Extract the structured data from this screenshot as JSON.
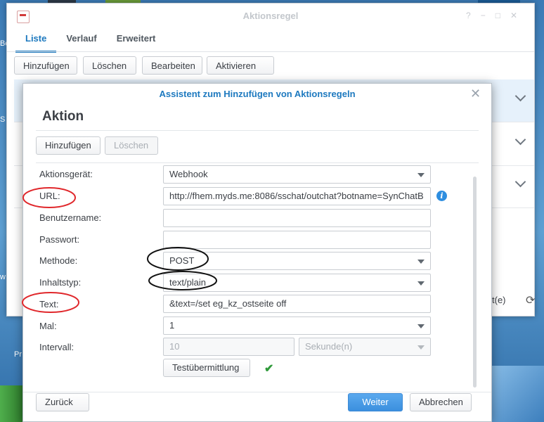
{
  "window": {
    "title": "Aktionsregel",
    "tabs": [
      {
        "label": "Liste",
        "active": true
      },
      {
        "label": "Verlauf",
        "active": false
      },
      {
        "label": "Erweitert",
        "active": false
      }
    ],
    "toolbar": {
      "add": "Hinzufügen",
      "delete": "Löschen",
      "edit": "Bearbeiten",
      "activate": "Aktivieren"
    },
    "footer_text": "t(e)"
  },
  "desktop": {
    "left_labels": [
      "Be",
      "S",
      "w",
      "Pr"
    ]
  },
  "dialog": {
    "title": "Assistent zum Hinzufügen von Aktionsregeln",
    "heading": "Aktion",
    "add_button": "Hinzufügen",
    "delete_button": "Löschen",
    "fields": {
      "device": {
        "label": "Aktionsgerät:",
        "value": "Webhook"
      },
      "url": {
        "label": "URL:",
        "value": "http://fhem.myds.me:8086/sschat/outchat?botname=SynChatB"
      },
      "username": {
        "label": "Benutzername:",
        "value": ""
      },
      "password": {
        "label": "Passwort:",
        "value": ""
      },
      "method": {
        "label": "Methode:",
        "value": "POST"
      },
      "content_type": {
        "label": "Inhaltstyp:",
        "value": "text/plain"
      },
      "text": {
        "label": "Text:",
        "value": "&text=/set eg_kz_ostseite off"
      },
      "times": {
        "label": "Mal:",
        "value": "1"
      },
      "interval": {
        "label": "Intervall:",
        "value": "10",
        "unit": "Sekunde(n)"
      }
    },
    "test_button": "Testübermittlung",
    "back_button": "Zurück",
    "next_button": "Weiter",
    "cancel_button": "Abbrechen",
    "colors": {
      "accent": "#1d79bf",
      "primary": "#3b8fde",
      "annotation_red": "#e0272b"
    }
  }
}
